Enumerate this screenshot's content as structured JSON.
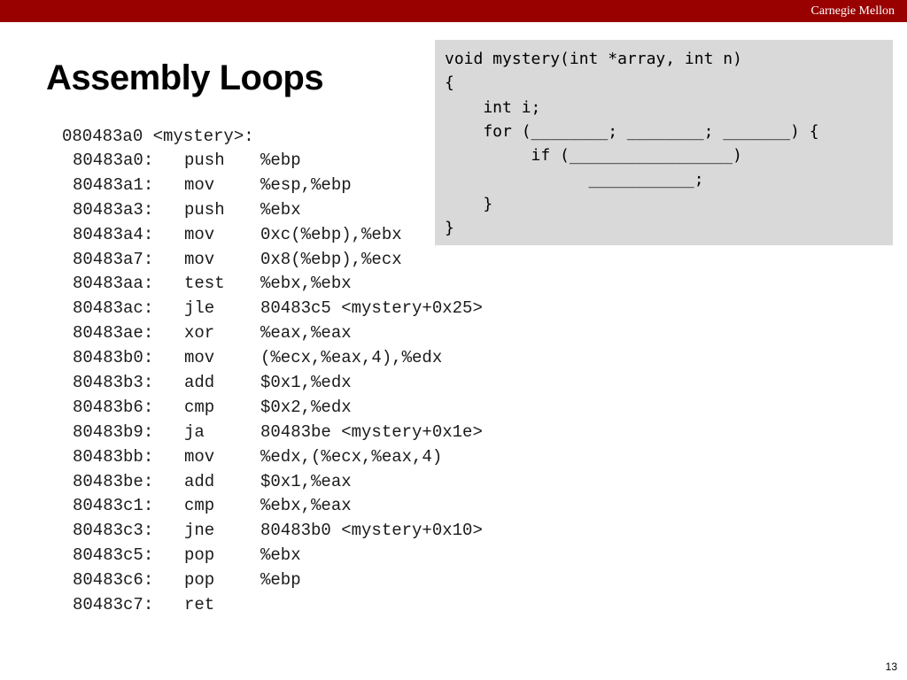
{
  "header": {
    "brand": "Carnegie Mellon",
    "bar_color": "#990000"
  },
  "slide": {
    "title": "Assembly Loops",
    "page_number": "13"
  },
  "assembly": {
    "header": "080483a0 <mystery>:",
    "rows": [
      {
        "addr": "80483a0:",
        "op": "push",
        "args": "%ebp"
      },
      {
        "addr": "80483a1:",
        "op": "mov",
        "args": "%esp,%ebp"
      },
      {
        "addr": "80483a3:",
        "op": "push",
        "args": "%ebx"
      },
      {
        "addr": "80483a4:",
        "op": "mov",
        "args": "0xc(%ebp),%ebx"
      },
      {
        "addr": "80483a7:",
        "op": "mov",
        "args": "0x8(%ebp),%ecx"
      },
      {
        "addr": "80483aa:",
        "op": "test",
        "args": "%ebx,%ebx"
      },
      {
        "addr": "80483ac:",
        "op": "jle",
        "args": "80483c5 <mystery+0x25>"
      },
      {
        "addr": "80483ae:",
        "op": "xor",
        "args": "%eax,%eax"
      },
      {
        "addr": "80483b0:",
        "op": "mov",
        "args": "(%ecx,%eax,4),%edx"
      },
      {
        "addr": "80483b3:",
        "op": "add",
        "args": "$0x1,%edx"
      },
      {
        "addr": "80483b6:",
        "op": "cmp",
        "args": "$0x2,%edx"
      },
      {
        "addr": "80483b9:",
        "op": "ja",
        "args": "80483be <mystery+0x1e>"
      },
      {
        "addr": "80483bb:",
        "op": "mov",
        "args": "%edx,(%ecx,%eax,4)"
      },
      {
        "addr": "80483be:",
        "op": "add",
        "args": "$0x1,%eax"
      },
      {
        "addr": "80483c1:",
        "op": "cmp",
        "args": "%ebx,%eax"
      },
      {
        "addr": "80483c3:",
        "op": "jne",
        "args": "80483b0 <mystery+0x10>"
      },
      {
        "addr": "80483c5:",
        "op": "pop",
        "args": "%ebx"
      },
      {
        "addr": "80483c6:",
        "op": "pop",
        "args": "%ebp"
      },
      {
        "addr": "80483c7:",
        "op": "ret",
        "args": ""
      }
    ]
  },
  "c_code": {
    "lines": [
      "void mystery(int *array, int n)",
      "{",
      "    int i;",
      "    for (________; ________; _______) {",
      "         if (_________________)",
      "               ___________;",
      "    }",
      "}"
    ]
  }
}
